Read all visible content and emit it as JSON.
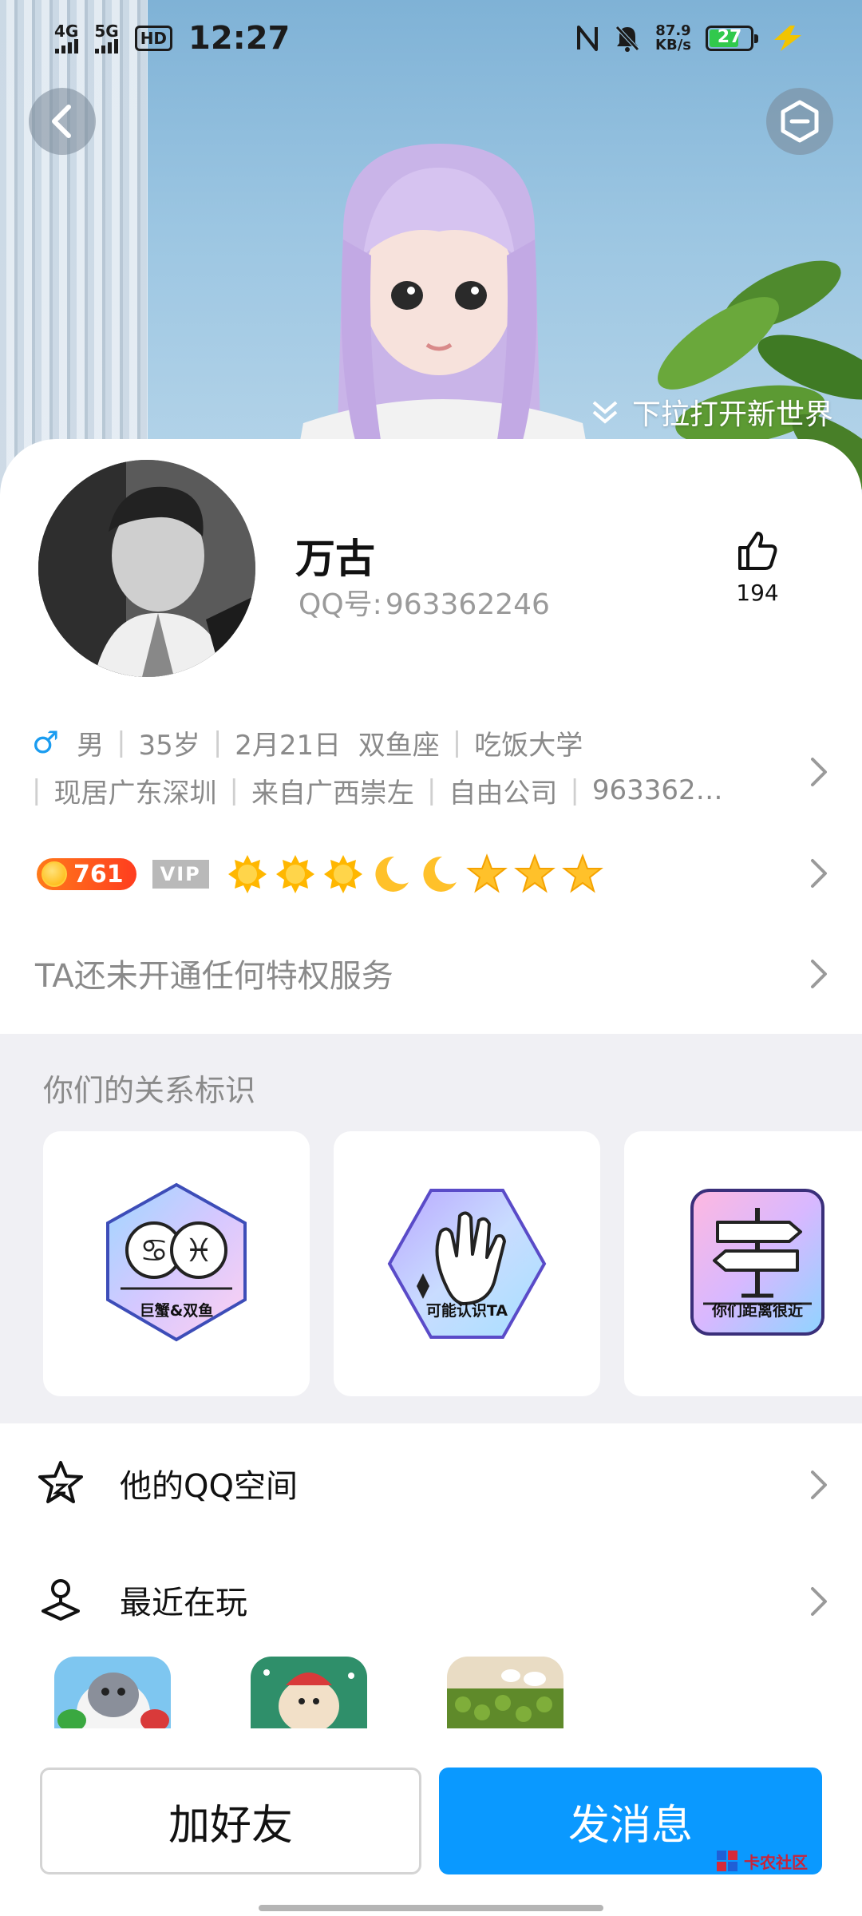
{
  "status_bar": {
    "time": "12:27",
    "net1": "4G",
    "net2": "5G",
    "hd": "HD",
    "speed_value": "87.9",
    "speed_unit": "KB/s",
    "battery": "27"
  },
  "hero": {
    "pull_hint": "下拉打开新世界"
  },
  "profile": {
    "name": "万古",
    "qq_label": "QQ号:",
    "qq_number": "963362246",
    "likes": "194"
  },
  "info": {
    "gender_symbol": "♂",
    "line1": [
      "男",
      "35岁",
      "2月21日  双鱼座",
      "吃饭大学"
    ],
    "line2": [
      "现居广东深圳",
      "来自广西崇左",
      "自由公司",
      "963362…"
    ]
  },
  "level": {
    "value": "761",
    "vip": "VIP",
    "icons": [
      "sun-icon",
      "sun-icon",
      "sun-icon",
      "moon-icon",
      "moon-icon",
      "star-icon",
      "star-icon",
      "star-icon"
    ]
  },
  "privilege": {
    "text": "TA还未开通任何特权服务"
  },
  "relations": {
    "title": "你们的关系标识",
    "cards": [
      {
        "label": "巨蟹&双鱼"
      },
      {
        "label": "可能认识TA"
      },
      {
        "label": "你们距离很近"
      }
    ]
  },
  "menu": {
    "qzone": "他的QQ空间",
    "recent_play": "最近在玩"
  },
  "actions": {
    "add_friend": "加好友",
    "send_message": "发消息"
  },
  "watermark": "卡农社区",
  "colors": {
    "primary": "#0a99ff",
    "male": "#1a9cf0",
    "level": "#ff3d1f",
    "gold": "#ffc12a"
  }
}
